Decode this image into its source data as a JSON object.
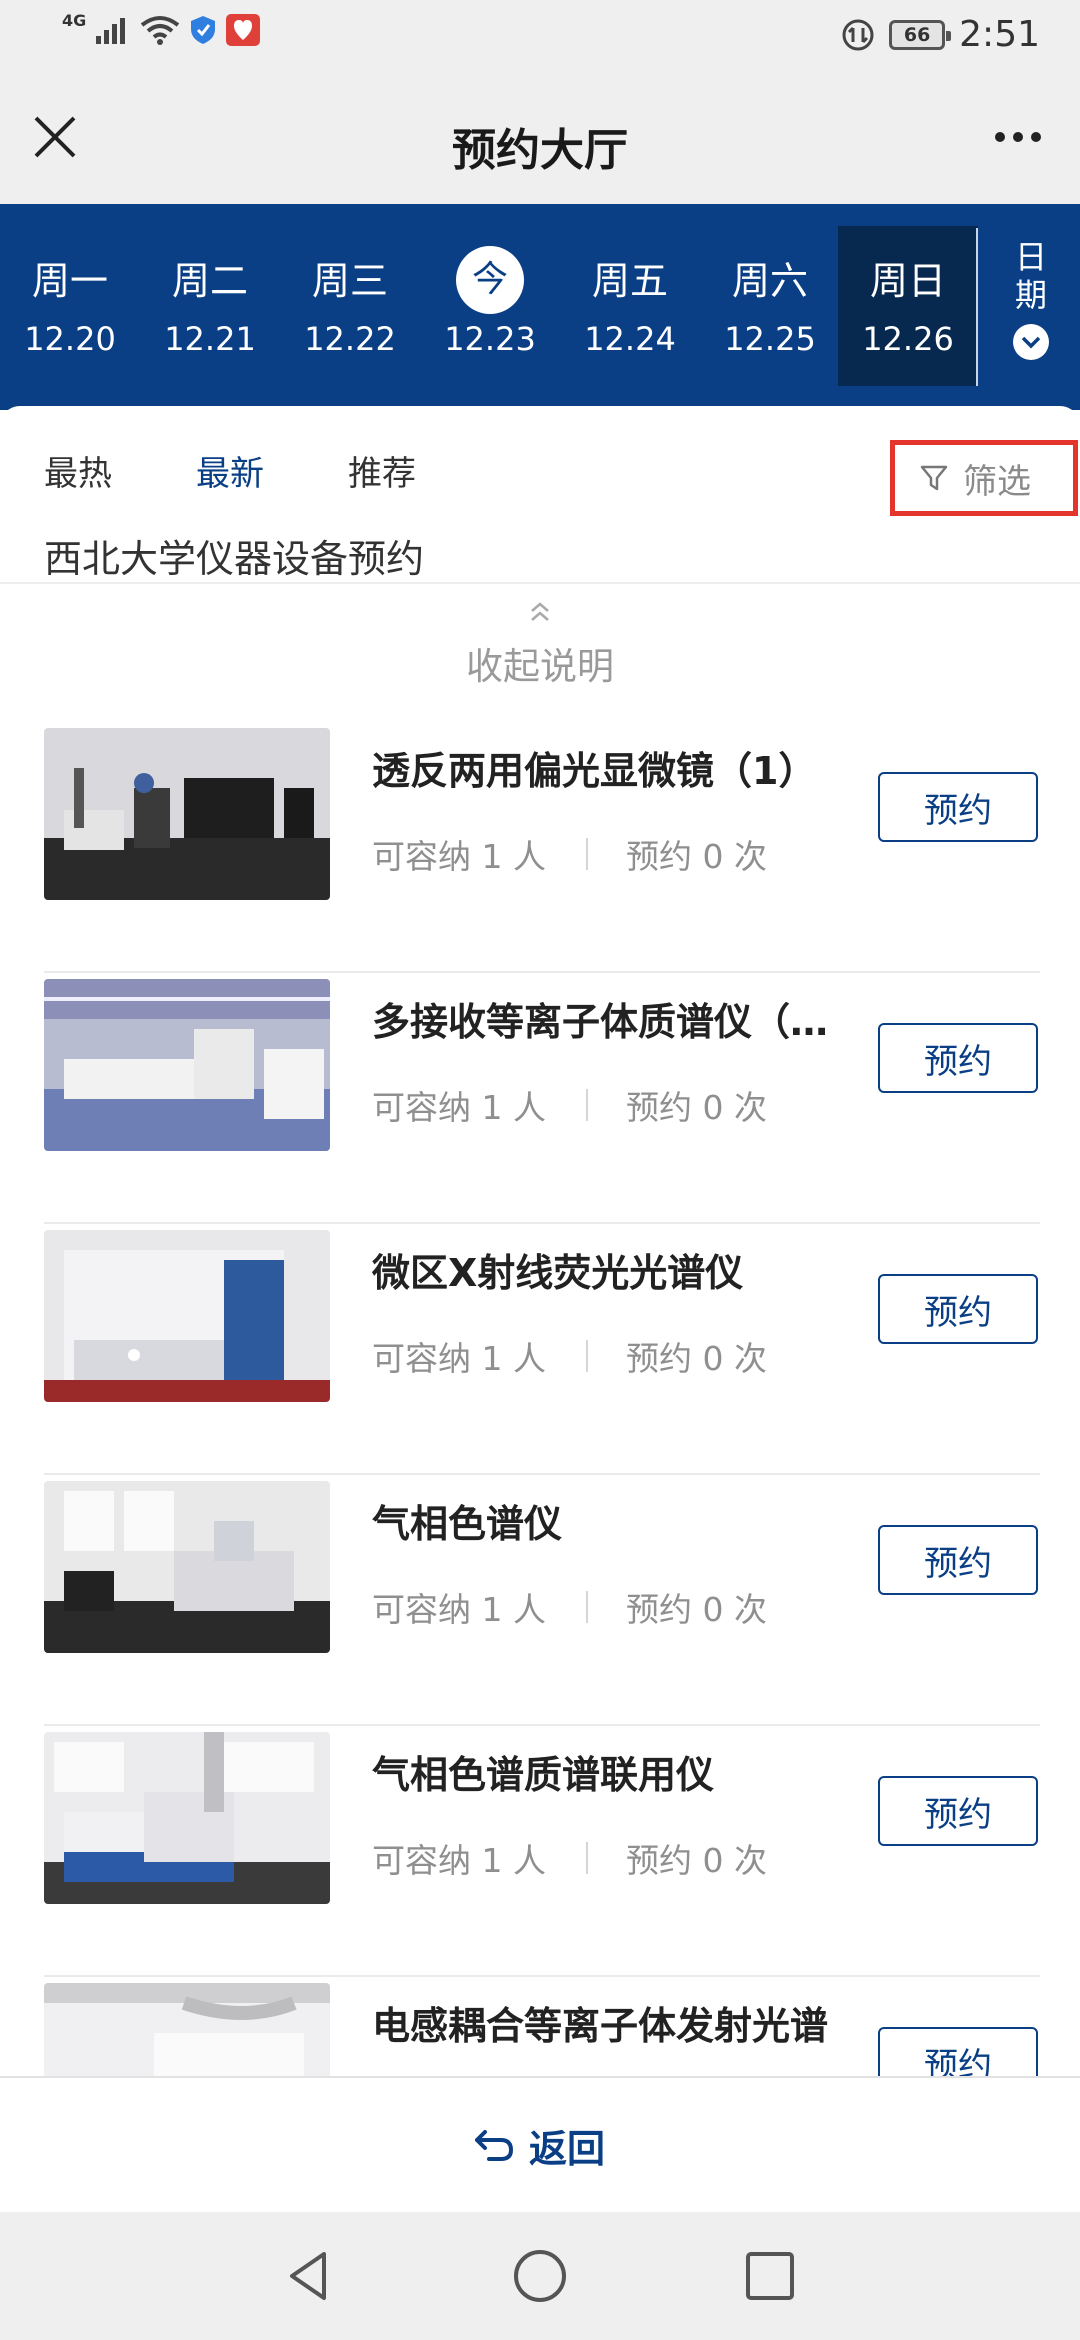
{
  "status_bar": {
    "network": "4G",
    "battery": "66",
    "time": "2:51",
    "icons": [
      "signal-icon",
      "wifi-icon",
      "shield-icon",
      "app-notification-icon",
      "data-saver-icon",
      "battery-icon"
    ]
  },
  "header": {
    "title": "预约大厅",
    "close_icon": "close-icon",
    "more_icon": "more-icon"
  },
  "week": {
    "days": [
      {
        "name": "周一",
        "date": "12.20"
      },
      {
        "name": "周二",
        "date": "12.21"
      },
      {
        "name": "周三",
        "date": "12.22"
      },
      {
        "name": "今",
        "date": "12.23"
      },
      {
        "name": "周五",
        "date": "12.24"
      },
      {
        "name": "周六",
        "date": "12.25"
      },
      {
        "name": "周日",
        "date": "12.26"
      }
    ],
    "date_picker_label": "日期",
    "selected": "周日",
    "today": "今"
  },
  "filters": {
    "sort_tabs": [
      "最热",
      "最新",
      "推荐"
    ],
    "active_tab": "最新",
    "filter_label": "筛选"
  },
  "section": {
    "subtitle": "西北大学仪器设备预约",
    "collapse_label": "收起说明"
  },
  "items": [
    {
      "name": "透反两用偏光显微镜（1）",
      "capacity": "可容纳 1 人",
      "bookings": "预约 0 次",
      "button": "预约"
    },
    {
      "name": "多接收等离子体质谱仪（…",
      "capacity": "可容纳 1 人",
      "bookings": "预约 0 次",
      "button": "预约"
    },
    {
      "name": "微区X射线荧光光谱仪",
      "capacity": "可容纳 1 人",
      "bookings": "预约 0 次",
      "button": "预约"
    },
    {
      "name": "气相色谱仪",
      "capacity": "可容纳 1 人",
      "bookings": "预约 0 次",
      "button": "预约"
    },
    {
      "name": "气相色谱质谱联用仪",
      "capacity": "可容纳 1 人",
      "bookings": "预约 0 次",
      "button": "预约"
    },
    {
      "name": "电感耦合等离子体发射光谱",
      "capacity": "",
      "bookings": "",
      "button": "预约"
    }
  ],
  "footer": {
    "return_label": "返回"
  },
  "colors": {
    "primary": "#0b3f85",
    "selected_day": "#07294f",
    "highlight_border": "#e4352d"
  }
}
